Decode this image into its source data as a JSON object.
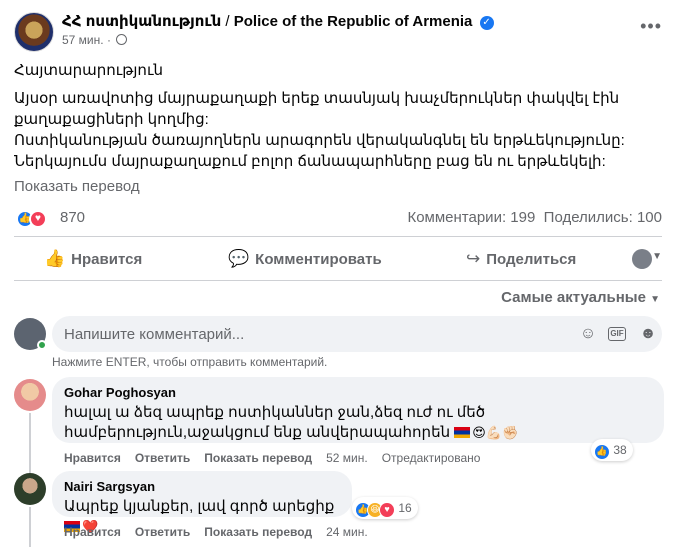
{
  "post": {
    "page_name": "ՀՀ ոստիկանություն",
    "page_name_separator": "/",
    "page_name_en": "Police of the Republic of Armenia",
    "time": "57 мин.",
    "dot": "·",
    "lines": [
      "Հայտարարություն",
      "Այսօր առավոտից մայրաքաղաքի երեք տասնյակ խաչմերուկներ փակվել էին քաղաքացիների կողմից:",
      "Ոստիկանության ծառայողներն արագորեն վերականգնել են երթևեկությունը:",
      "Ներկայումս մայրաքաղաքում բոլոր ճանապարհները բաց են ու երթևեկելի:"
    ],
    "translate_label": "Показать перевод",
    "reaction_count": "870",
    "comments_count": "Комментарии: 199",
    "shares_count": "Поделились: 100"
  },
  "actions": {
    "like": "Нравится",
    "comment": "Комментировать",
    "share": "Поделиться"
  },
  "sort_label": "Самые актуальные",
  "composer": {
    "placeholder": "Напишите комментарий...",
    "hint": "Нажмите ENTER, чтобы отправить комментарий.",
    "gif_label": "GIF"
  },
  "comments": [
    {
      "author": "Gohar Poghosyan",
      "text": "հալալ ա ձեզ ապրեք ոստիկաններ ջան,ձեզ ուժ ու մեծ համբերություն,աջակցում ենք անվերապահորեն",
      "emojis": "😍💪🏻✊🏻",
      "like": "Нравится",
      "reply": "Ответить",
      "translate": "Показать перевод",
      "time": "52 мин.",
      "edited": "Отредактировано",
      "reactions": "38"
    },
    {
      "author": "Nairi Sargsyan",
      "text": "Ապրեք կյանքեր, լավ գործ արեցիք",
      "emojis": "❤️",
      "like": "Нравится",
      "reply": "Ответить",
      "translate": "Показать перевод",
      "time": "24 мин.",
      "reactions": "16"
    }
  ],
  "colors": {
    "accent": "#1877f2",
    "love": "#f33e58",
    "muted": "#65676b",
    "bubble": "#f0f2f5"
  },
  "icons": [
    "verified-badge-icon",
    "globe-icon",
    "more-options-icon",
    "like-icon",
    "love-icon",
    "comment-icon",
    "share-icon",
    "emoji-icon",
    "gif-icon",
    "sticker-icon",
    "chevron-down-icon",
    "armenia-flag-icon",
    "haha-icon"
  ]
}
